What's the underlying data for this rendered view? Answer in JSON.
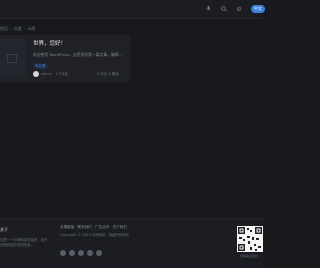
{
  "header": {
    "icons": [
      "microphone-icon",
      "search-icon",
      "settings-icon"
    ],
    "lang_badge": "中文"
  },
  "breadcrumb": [
    "首页",
    "分类",
    "示例"
  ],
  "post": {
    "title": "世界，您好！",
    "excerpt": "欢迎使用 WordPress。这是您的第一篇文章。编辑…",
    "tag": "未分类",
    "author": "admin",
    "time": "1个月前",
    "stats": "0 评论 0 喜欢"
  },
  "footer": {
    "left_title": "关于",
    "left_desc": [
      "这是一个示例网站的描述，用于展示",
      "页面底部的说明信息。"
    ],
    "links": [
      "友情链接",
      "联系我们",
      "广告合作",
      "关于我们"
    ],
    "copyright": "Copyright © 2024 示例网站 · 保留所有权利",
    "social_icons": [
      "wechat-icon",
      "weibo-icon",
      "qq-icon",
      "github-icon",
      "email-icon"
    ],
    "qr_caption": "扫码关注我们"
  },
  "colors": {
    "background": "#17191d",
    "card": "#1f2126",
    "accent": "#3c7fde"
  }
}
